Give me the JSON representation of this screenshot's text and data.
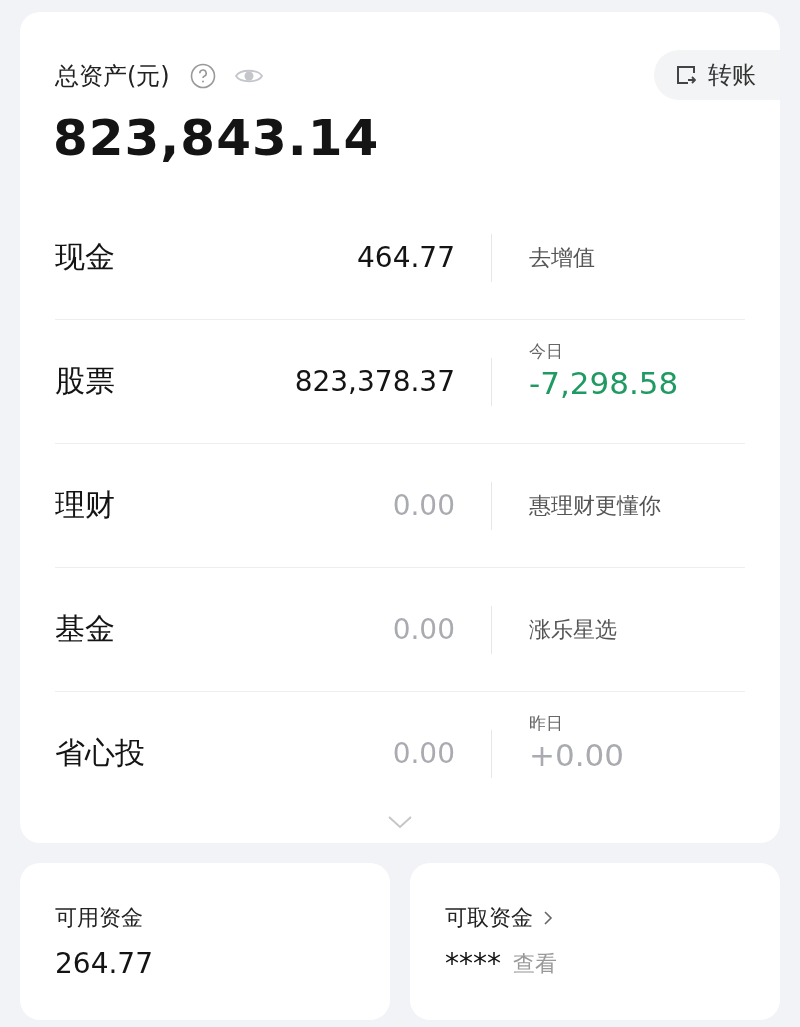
{
  "summary": {
    "title": "总资产(元)",
    "total": "823,843.14",
    "transfer_button": "转账"
  },
  "rows": [
    {
      "label": "现金",
      "value": "464.77",
      "dimmed": false,
      "kind": "text",
      "side_text": "去增值"
    },
    {
      "label": "股票",
      "value": "823,378.37",
      "dimmed": false,
      "kind": "change",
      "caption": "今日",
      "change": "-7,298.58",
      "color": "#1f9a62"
    },
    {
      "label": "理财",
      "value": "0.00",
      "dimmed": true,
      "kind": "text",
      "side_text": "惠理财更懂你"
    },
    {
      "label": "基金",
      "value": "0.00",
      "dimmed": true,
      "kind": "text",
      "side_text": "涨乐星选"
    },
    {
      "label": "省心投",
      "value": "0.00",
      "dimmed": true,
      "kind": "change",
      "caption": "昨日",
      "change": "+0.00",
      "color": "#a9abb0"
    }
  ],
  "available_funds": {
    "label": "可用资金",
    "value": "264.77"
  },
  "withdrawable_funds": {
    "label": "可取资金",
    "value": "****",
    "link": "查看"
  }
}
